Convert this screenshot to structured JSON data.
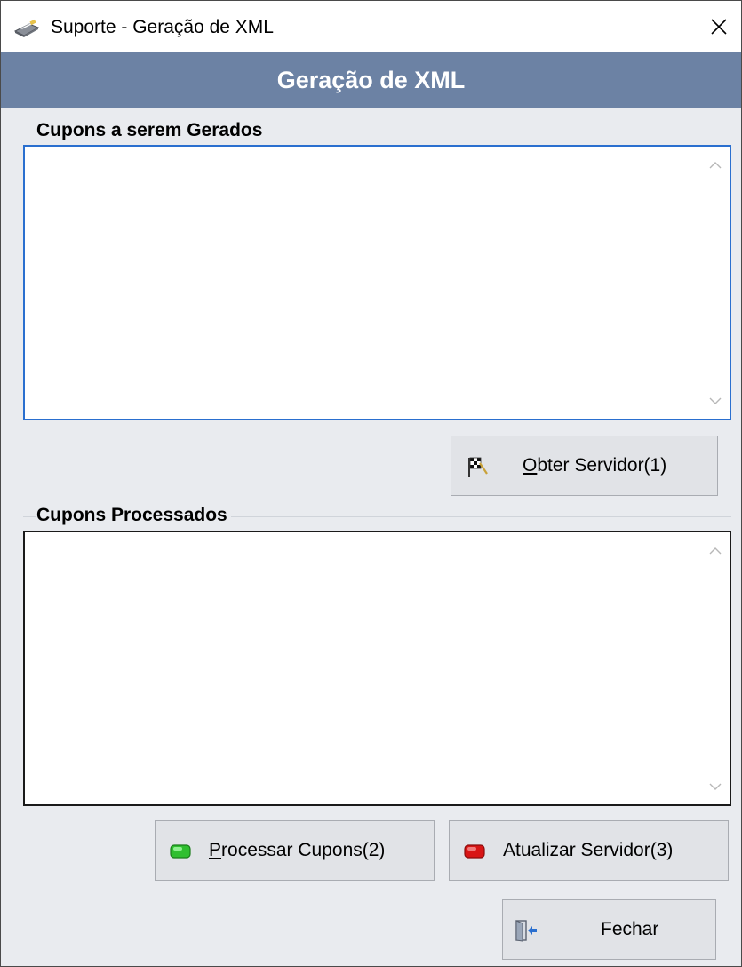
{
  "window": {
    "title": "Suporte - Geração de XML",
    "header": "Geração de XML"
  },
  "groups": {
    "gerados": {
      "title": "Cupons a serem Gerados",
      "items": []
    },
    "processados": {
      "title": "Cupons Processados",
      "items": []
    }
  },
  "buttons": {
    "obter": {
      "mnemonic": "O",
      "rest": "bter Servidor(1)",
      "icon": "checkered-flag-icon"
    },
    "processar": {
      "mnemonic": "P",
      "rest": "rocessar Cupons(2)",
      "icon": "green-led-icon",
      "color": "#2fbf2f"
    },
    "atualizar": {
      "label": "Atualizar Servidor(3)",
      "icon": "red-led-icon",
      "color": "#d81515"
    },
    "fechar": {
      "label": "Fechar",
      "icon": "exit-door-icon"
    }
  },
  "colors": {
    "header_band": "#6c82a4",
    "window_bg": "#e9ebef",
    "focus_border": "#2a6fcf"
  }
}
